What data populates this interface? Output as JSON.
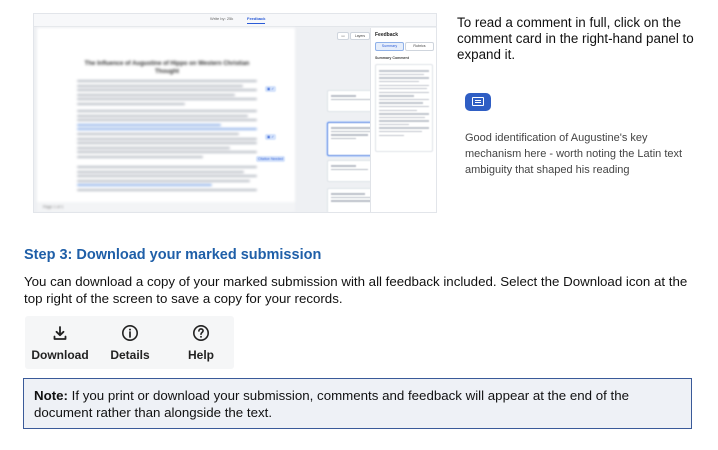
{
  "screenshot": {
    "tabs": [
      "Write by: 25k",
      "Feedback"
    ],
    "document_title": "The Influence of Augustine of Hippo on Western Christian Thought",
    "footer_page": "Page 1 of 1",
    "feedback_panel": {
      "title": "Feedback",
      "buttons": [
        "Summary",
        "Rubrics"
      ],
      "section": "Summary Comment"
    },
    "mini_buttons": [
      "Layers"
    ],
    "comment_cards": [
      "Good point",
      "Good identification of Augustine's key mechanism here",
      "Good point",
      "Citation Needed"
    ],
    "markers": [
      "Citation Needed"
    ]
  },
  "intro_text": "To read a comment in full, click on the comment card in the right-hand panel to expand it.",
  "comment_icon": "comment-icon",
  "example_comment": "Good identification of Augustine's key mechanism here - worth noting the Latin text ambiguity that shaped his reading",
  "step": {
    "heading": "Step 3: Download your marked submission",
    "body": "You can download a copy of your marked submission with all feedback included. Select the Download icon at the top right of the screen to save a copy for your records."
  },
  "toolbar": {
    "items": [
      {
        "label": "Download",
        "icon": "download-icon"
      },
      {
        "label": "Details",
        "icon": "info-icon"
      },
      {
        "label": "Help",
        "icon": "help-icon"
      }
    ]
  },
  "note": {
    "label": "Note:",
    "text": " If you print or download your submission, comments and feedback will appear at the end of the document rather than alongside the text."
  },
  "colors": {
    "heading": "#1f5fa8",
    "accent": "#2f5ec4",
    "note_border": "#3a5a99",
    "note_bg": "#eef1f6"
  }
}
